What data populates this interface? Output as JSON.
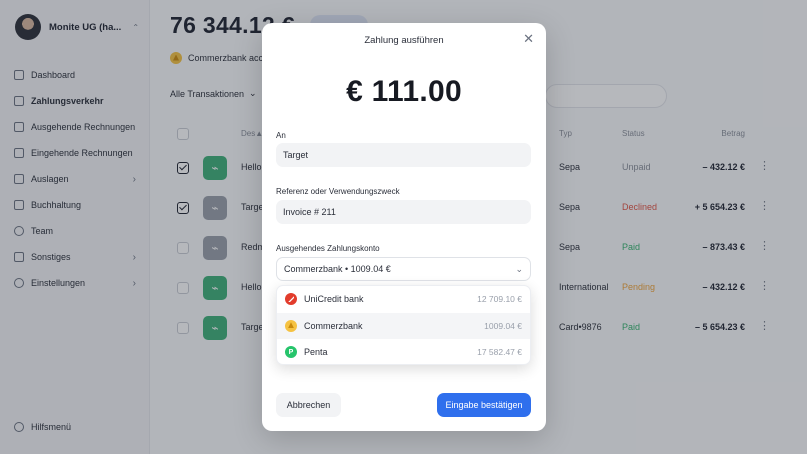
{
  "sidebar": {
    "org_name": "Monite UG (ha...",
    "items": [
      {
        "label": "Dashboard"
      },
      {
        "label": "Zahlungsverkehr"
      },
      {
        "label": "Ausgehende Rechnungen"
      },
      {
        "label": "Eingehende Rechnungen"
      },
      {
        "label": "Auslagen"
      },
      {
        "label": "Buchhaltung"
      },
      {
        "label": "Team"
      },
      {
        "label": "Sonstiges"
      },
      {
        "label": "Einstellungen"
      }
    ],
    "help_label": "Hilfsmenü"
  },
  "main": {
    "balance": "76 344.12 €",
    "account_label": "Commerzbank acco",
    "filter_label": "Alle Transaktionen",
    "columns": {
      "desc": "Des▲",
      "type": "Typ",
      "status": "Status",
      "amount": "Betrag"
    },
    "rows": [
      {
        "name": "Hello",
        "type": "Sepa",
        "status": "Unpaid",
        "amount": "– 432.12 €"
      },
      {
        "name": "Targe",
        "type": "Sepa",
        "status": "Declined",
        "amount": "+ 5 654.23 €"
      },
      {
        "name": "Redm",
        "type": "Sepa",
        "status": "Paid",
        "amount": "– 873.43 €"
      },
      {
        "name": "Hello",
        "type": "International",
        "status": "Pending",
        "amount": "– 432.12 €"
      },
      {
        "name": "Targe",
        "type": "Card•9876",
        "status": "Paid",
        "amount": "– 5 654.23 €"
      }
    ],
    "status_colors": {
      "Unpaid": "#8a8f9a",
      "Declined": "#e25545",
      "Paid": "#35b46f",
      "Pending": "#f0a43a"
    }
  },
  "modal": {
    "title": "Zahlung ausführen",
    "close_glyph": "✕",
    "amount": "€ 111.00",
    "recipient_label": "An",
    "recipient_value": "Target",
    "reference_label": "Referenz oder Verwendungszweck",
    "reference_value": "Invoice # 211",
    "account_label": "Ausgehendes Zahlungskonto",
    "account_selected": "Commerzbank • 1009.04 €",
    "options": [
      {
        "name": "UniCredit bank",
        "balance": "12 709.10 €"
      },
      {
        "name": "Commerzbank",
        "balance": "1009.04 €"
      },
      {
        "name": "Penta",
        "balance": "17 582.47 €"
      }
    ],
    "cancel_label": "Abbrechen",
    "confirm_label": "Eingabe bestätigen"
  },
  "colors": {
    "accent": "#2f6fed",
    "overlay": "rgba(34,39,52,0.33)"
  }
}
